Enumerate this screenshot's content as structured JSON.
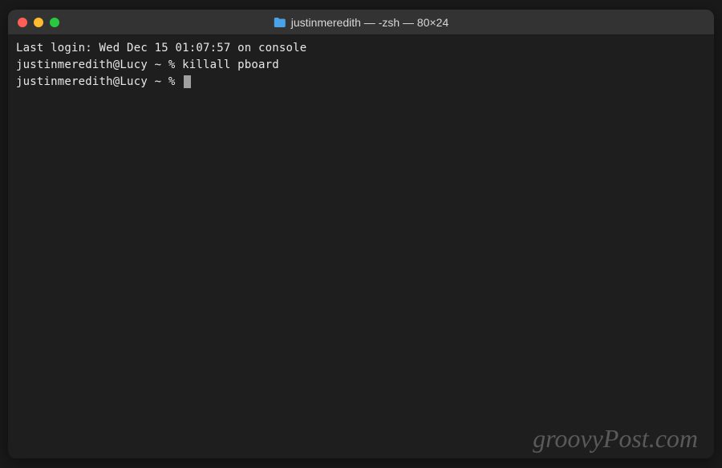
{
  "titlebar": {
    "icon": "folder-icon",
    "title": "justinmeredith — -zsh — 80×24"
  },
  "traffic_lights": {
    "close": "close-button",
    "minimize": "minimize-button",
    "maximize": "maximize-button"
  },
  "terminal": {
    "lines": [
      "Last login: Wed Dec 15 01:07:57 on console",
      "justinmeredith@Lucy ~ % killall pboard",
      "justinmeredith@Lucy ~ % "
    ]
  },
  "watermark": "groovyPost.com"
}
